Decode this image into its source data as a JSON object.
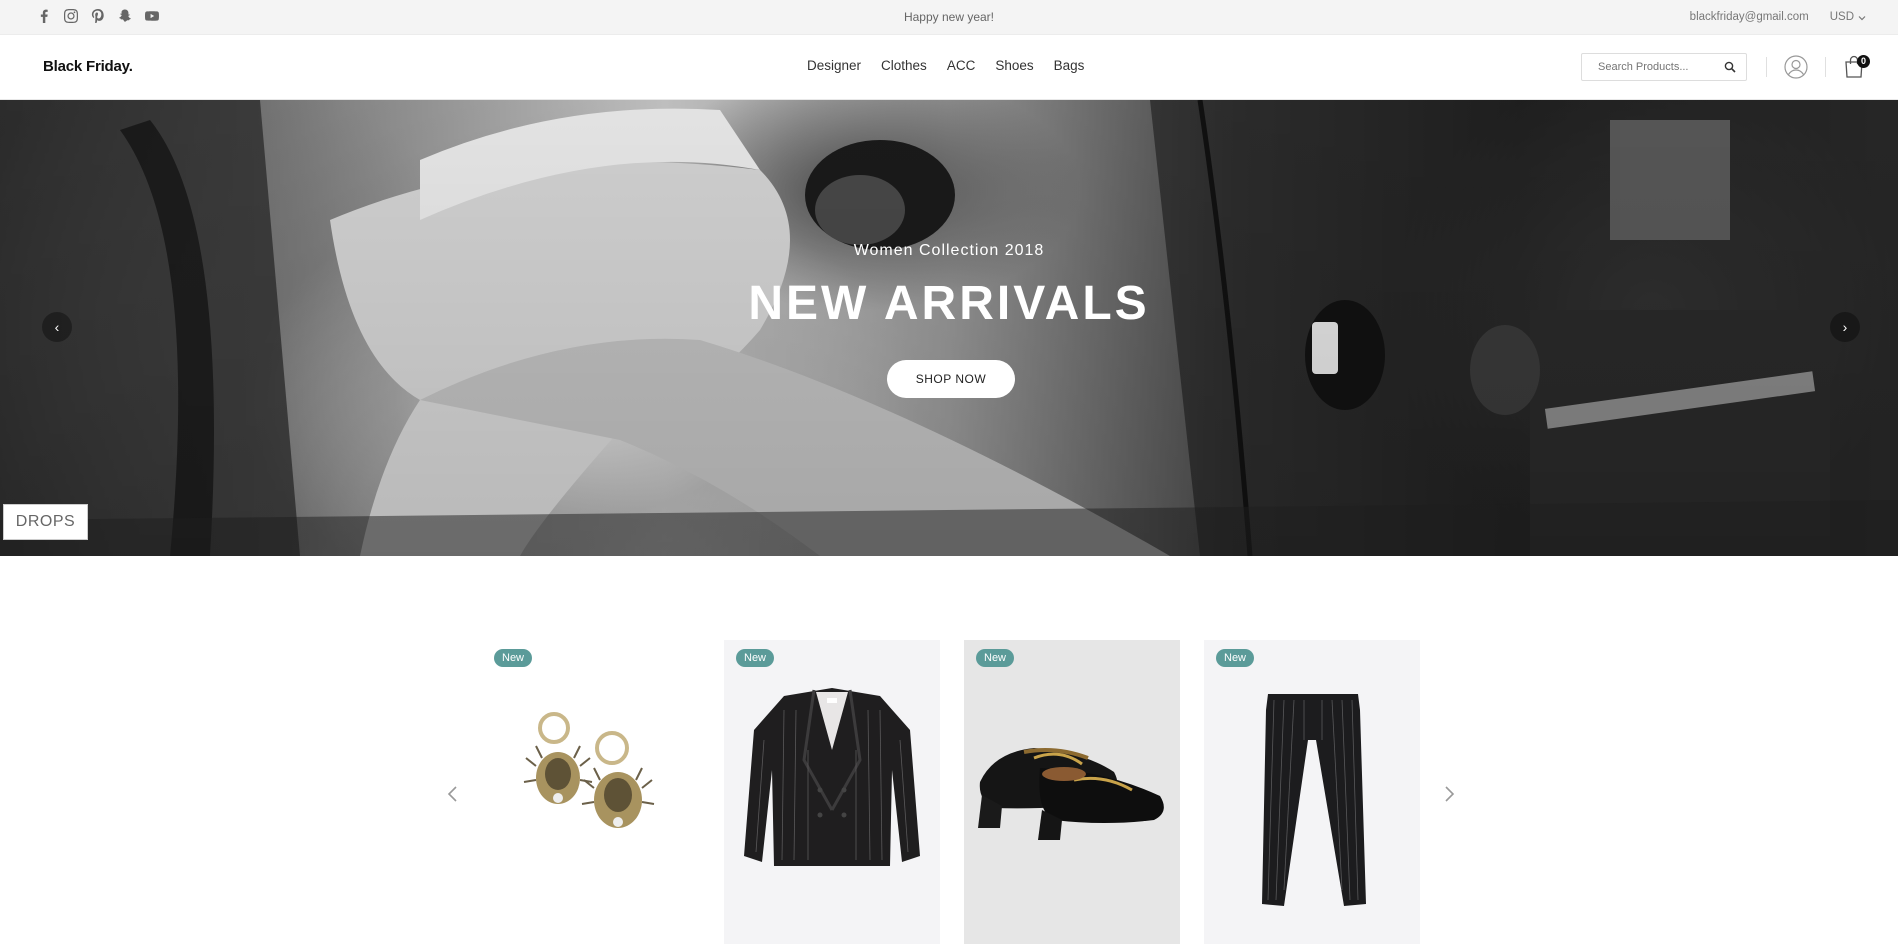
{
  "topbar": {
    "social_icons": [
      "facebook-icon",
      "instagram-icon",
      "pinterest-icon",
      "snapchat-icon",
      "youtube-icon"
    ],
    "announcement": "Happy new year!",
    "email": "blackfriday@gmail.com",
    "currency": "USD"
  },
  "header": {
    "logo": "Black Friday.",
    "nav": [
      "Designer",
      "Clothes",
      "ACC",
      "Shoes",
      "Bags"
    ],
    "search_placeholder": "Search Products...",
    "cart_count": "0"
  },
  "hero": {
    "subtitle": "Women Collection 2018",
    "title": "NEW ARRIVALS",
    "button": "SHOP NOW",
    "prev_icon": "chevron-left-icon",
    "next_icon": "chevron-right-icon",
    "drops_label": "DROPS"
  },
  "products": [
    {
      "badge": "New",
      "image": "earrings",
      "background": "#ffffff"
    },
    {
      "badge": "New",
      "image": "pinstripe-blazer",
      "background": "#f4f4f6"
    },
    {
      "badge": "New",
      "image": "horsebit-loafers",
      "background": "#e6e6e6"
    },
    {
      "badge": "New",
      "image": "pinstripe-trousers",
      "background": "#f4f4f6"
    }
  ],
  "colors": {
    "badge": "#5b9b99",
    "topbar_bg": "#f4f4f4",
    "text": "#333333"
  }
}
